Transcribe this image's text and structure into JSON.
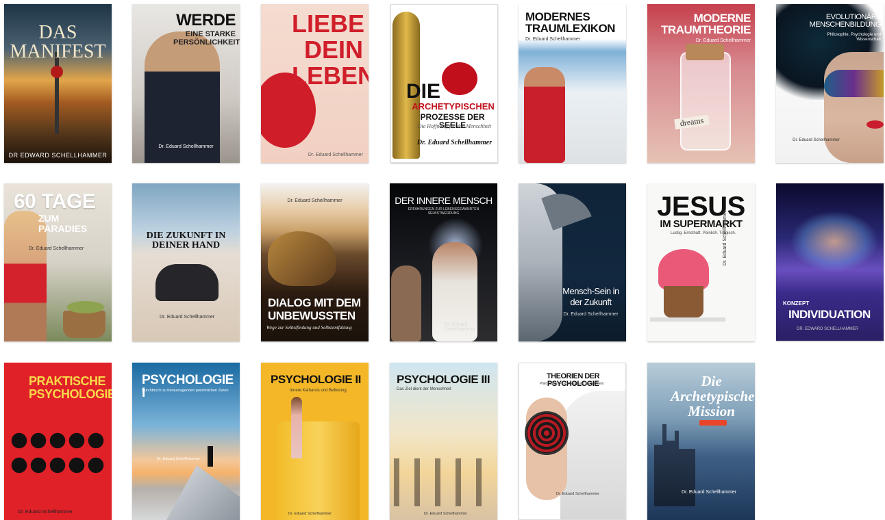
{
  "books": [
    {
      "title": "DAS MANIFEST",
      "subtitle": "",
      "author": "DR EDWARD SCHELLHAMMER",
      "extra": ""
    },
    {
      "title": "WERDE",
      "subtitle": "EINE STARKE PERSÖNLICHKEIT",
      "author": "Dr. Eduard Schellhammer",
      "extra": ""
    },
    {
      "title": "LIEBE DEIN LEBEN",
      "subtitle": "",
      "author": "Dr. Eduard Schellhammer",
      "extra": ""
    },
    {
      "title": "DIE",
      "subtitle": "ARCHETYPISCHEN",
      "author": "Dr. Eduard Schellhammer",
      "extra": "PROZESSE DER SEELE",
      "tagline": "Die Hoffnung für den Menschheit"
    },
    {
      "title": "MODERNES TRAUMLEXIKON",
      "subtitle": "",
      "author": "Dr. Eduard Schellhammer",
      "extra": ""
    },
    {
      "title": "MODERNE TRAUMTHEORIE",
      "subtitle": "",
      "author": "Dr. Eduard Schellhammer",
      "extra": "dreams"
    },
    {
      "title": "EVOLUTIONÄRE MENSCHENBILDUNG",
      "subtitle": "Philosophie, Psychologie und Wissenschaft",
      "author": "Dr. Eduard Schellhammer",
      "extra": ""
    },
    {
      "title": "60 TAGE",
      "subtitle": "ZUM PARADIES",
      "author": "Dr. Eduard Schellhammer",
      "extra": ""
    },
    {
      "title": "DIE ZUKUNFT IN DEINER HAND",
      "subtitle": "",
      "author": "Dr. Eduard Schellhammer",
      "extra": ""
    },
    {
      "title": "DIALOG MIT DEM UNBEWUSSTEN",
      "subtitle": "Wege zur Selbstfindung und Selbstentfaltung",
      "author": "Dr. Eduard Schellhammer",
      "extra": ""
    },
    {
      "title": "DER INNERE MENSCH",
      "subtitle": "ERFAHRUNGEN ZUR LEBENSGEWANDTEN SELBSTWERDUNG",
      "author": "Dr. Eduard Schellhammer",
      "extra": ""
    },
    {
      "title": "Mensch-Sein in der Zukunft",
      "subtitle": "",
      "author": "Dr. Eduard Schellhammer",
      "extra": ""
    },
    {
      "title": "JESUS",
      "subtitle": "IM SUPERMARKT",
      "author": "Dr. Eduard Schellhammer",
      "extra": "Lustig. Ernsthaft. Peinlich. Tragisch."
    },
    {
      "title": "INDIVIDUATION",
      "subtitle": "KONZEPT",
      "author": "DR. EDWARD SCHELLHAMMER",
      "extra": ""
    },
    {
      "title": "PRAKTISCHE PSYCHOLOGIE",
      "subtitle": "",
      "author": "Dr. Eduard Schellhammer",
      "extra": ""
    },
    {
      "title": "PSYCHOLOGIE I",
      "subtitle": "Durchbruch zu herausragenden persönlichen Zielen",
      "author": "Dr. Eduard Schellhammer",
      "extra": ""
    },
    {
      "title": "PSYCHOLOGIE II",
      "subtitle": "Innere Katharsis und Befreiung",
      "author": "Dr. Eduard Schellhammer",
      "extra": ""
    },
    {
      "title": "PSYCHOLOGIE III",
      "subtitle": "Das Ziel dient der Menschheit",
      "author": "Dr. Eduard Schellhammer",
      "extra": ""
    },
    {
      "title": "THEORIEN DER PSYCHOLOGIE",
      "subtitle": "Philosophie, Psychologie und Menschsein",
      "author": "Dr. Eduard Schellhammer",
      "extra": ""
    },
    {
      "title": "Die Archetypische Mission",
      "subtitle": "",
      "author": "Dr. Eduard Schellhammer",
      "extra": ""
    }
  ],
  "colors": {
    "accent_red": "#d21f27",
    "white": "#ffffff"
  }
}
